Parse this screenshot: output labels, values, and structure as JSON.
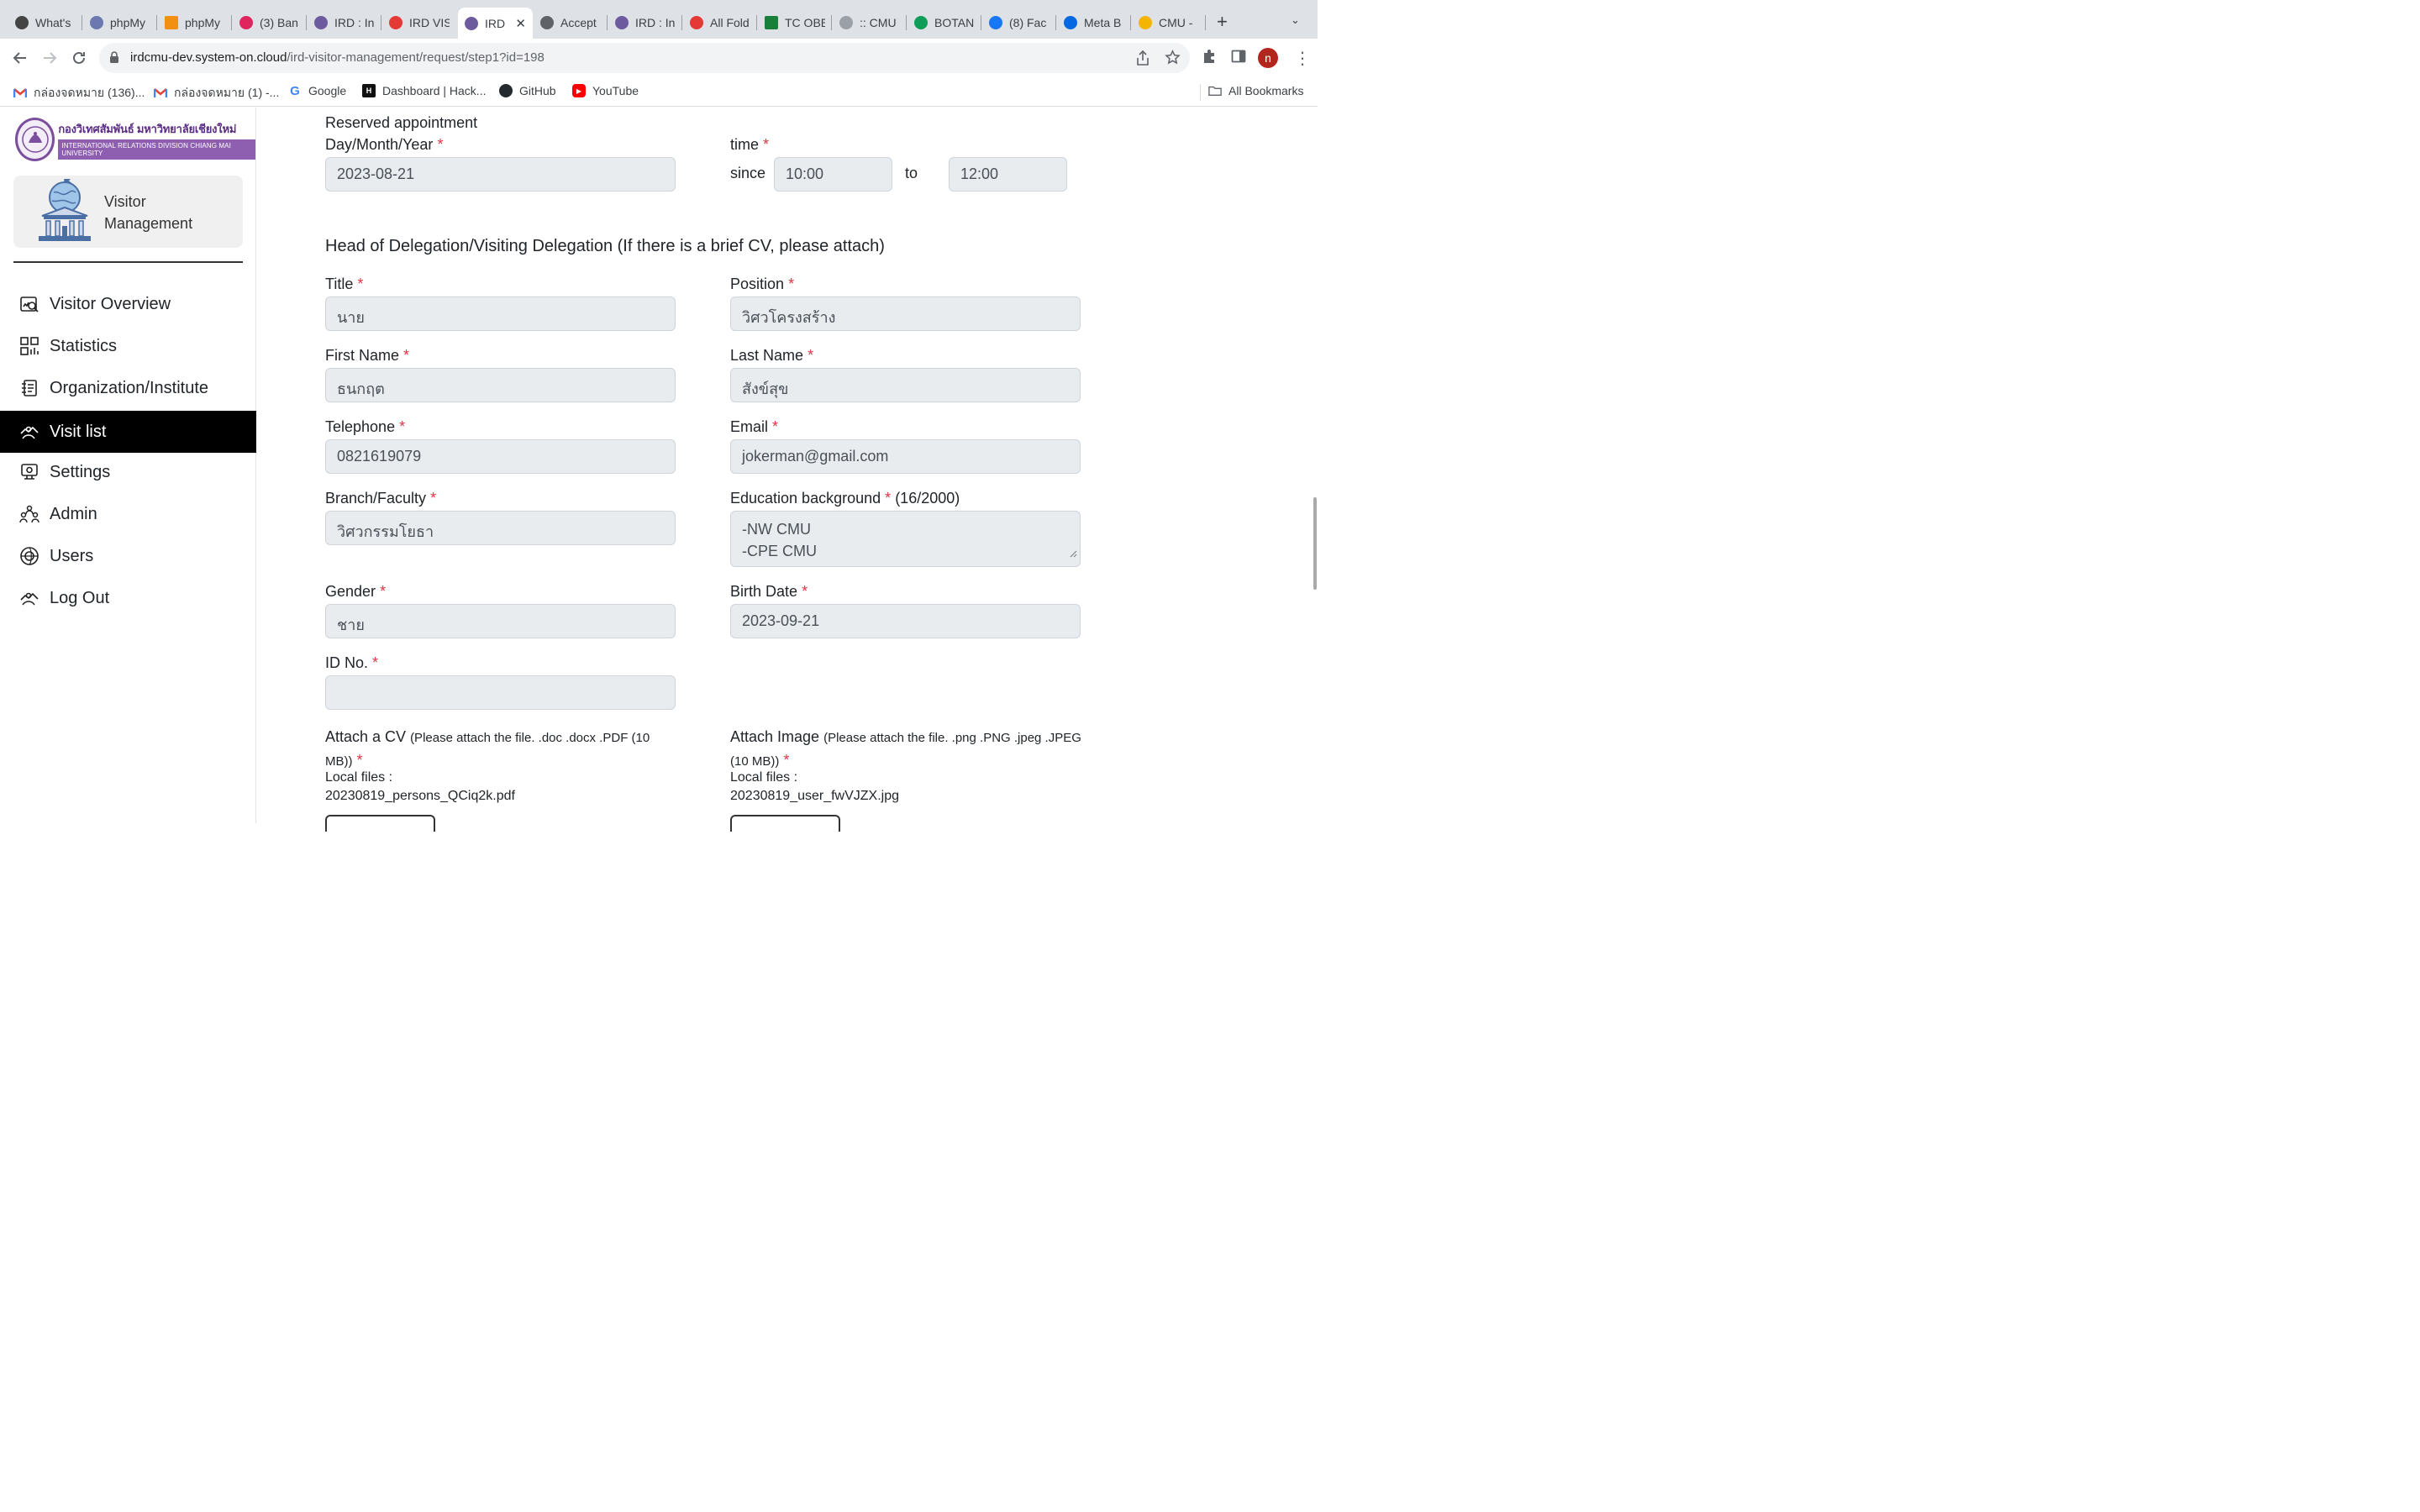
{
  "browser": {
    "tabs": [
      {
        "label": "What's",
        "color": "#444444"
      },
      {
        "label": "phpMy",
        "color": "#6c78af"
      },
      {
        "label": "phpMy",
        "color": "#f29111"
      },
      {
        "label": "(3) Ban",
        "color": "#e0245e"
      },
      {
        "label": "IRD : In",
        "color": "#6c5b9e"
      },
      {
        "label": "IRD VIS",
        "color": "#e53935"
      },
      {
        "label": "IRD",
        "color": "#6c5b9e",
        "active": true
      },
      {
        "label": "Accept",
        "color": "#5f6368"
      },
      {
        "label": "IRD : In",
        "color": "#6c5b9e"
      },
      {
        "label": "All Fold",
        "color": "#e53935"
      },
      {
        "label": "TC OBE",
        "color": "#188038"
      },
      {
        "label": ":: CMU",
        "color": "#9aa0a6"
      },
      {
        "label": "BOTAN",
        "color": "#0f9d58"
      },
      {
        "label": "(8) Fac",
        "color": "#1877f2"
      },
      {
        "label": "Meta B",
        "color": "#0668e1"
      },
      {
        "label": "CMU -",
        "color": "#f4b400"
      }
    ],
    "url_host": "irdcmu-dev.system-on.cloud",
    "url_path": "/ird-visitor-management/request/step1?id=198",
    "profile_initial": "n",
    "bookmarks": [
      {
        "label": "กล่องจดหมาย (136)...",
        "icon": "gmail-icon"
      },
      {
        "label": "กล่องจดหมาย (1) -...",
        "icon": "gmail-icon"
      },
      {
        "label": "Google",
        "icon": "google-icon"
      },
      {
        "label": "Dashboard | Hack...",
        "icon": "hackerrank-icon"
      },
      {
        "label": "GitHub",
        "icon": "github-icon"
      },
      {
        "label": "YouTube",
        "icon": "youtube-icon"
      }
    ],
    "all_bookmarks": "All Bookmarks"
  },
  "sidebar": {
    "logo_th": "กองวิเทศสัมพันธ์ มหาวิทยาลัยเชียงใหม่",
    "logo_en": "INTERNATIONAL RELATIONS DIVISION CHIANG MAI UNIVERSITY",
    "card_line1": "Visitor",
    "card_line2": "Management",
    "items": [
      {
        "label": "Visitor Overview",
        "icon": "visitor-overview-icon"
      },
      {
        "label": "Statistics",
        "icon": "statistics-icon"
      },
      {
        "label": "Organization/Institute",
        "icon": "organization-icon"
      },
      {
        "label": "Visit list",
        "icon": "visit-list-icon",
        "active": true
      },
      {
        "label": "Settings",
        "icon": "settings-icon"
      },
      {
        "label": "Admin",
        "icon": "admin-icon"
      },
      {
        "label": "Users",
        "icon": "users-icon"
      },
      {
        "label": "Log Out",
        "icon": "logout-icon"
      }
    ]
  },
  "form": {
    "reserved_heading": "Reserved appointment",
    "date_label": "Day/Month/Year",
    "date_value": "2023-08-21",
    "time_label": "time",
    "since_label": "since",
    "time_from": "10:00",
    "to_label": "to",
    "time_to": "12:00",
    "head_section_title": "Head of Delegation/Visiting Delegation (If there is a brief CV, please attach)",
    "title_label": "Title",
    "title_value": "นาย",
    "position_label": "Position",
    "position_value": "วิศวโครงสร้าง",
    "first_name_label": "First Name",
    "first_name_value": "ธนกฤต",
    "last_name_label": "Last Name",
    "last_name_value": "สังข์สุข",
    "telephone_label": "Telephone",
    "telephone_value": "0821619079",
    "email_label": "Email",
    "email_value": "jokerman@gmail.com",
    "branch_label": "Branch/Faculty",
    "branch_value": "วิศวกรรมโยธา",
    "education_label": "Education background",
    "education_counter": "(16/2000)",
    "education_line1": "-NW CMU",
    "education_line2": "-CPE CMU",
    "gender_label": "Gender",
    "gender_value": "ชาย",
    "birth_label": "Birth Date",
    "birth_value": "2023-09-21",
    "id_label": "ID No.",
    "id_value": "",
    "cv_label": "Attach a CV",
    "cv_hint_line1": "(Please attach the file. .doc .docx .PDF (10",
    "cv_hint_line2": "MB))",
    "cv_local_label": "Local files :",
    "cv_file": "20230819_persons_QCiq2k.pdf",
    "image_label": "Attach Image",
    "image_hint_line1": "(Please attach the file. .png .PNG .jpeg .JPEG",
    "image_hint_line2": "(10 MB))",
    "image_local_label": "Local files :",
    "image_file": "20230819_user_fwVJZX.jpg",
    "required_mark": "*"
  }
}
